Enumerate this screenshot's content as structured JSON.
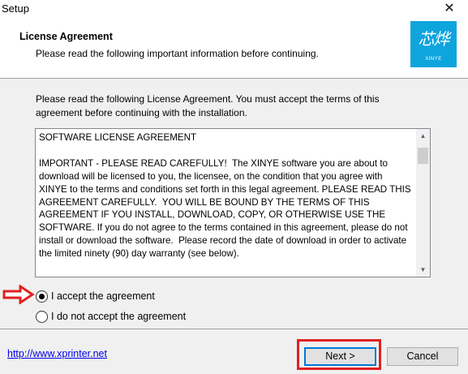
{
  "window": {
    "title": "Setup",
    "close_glyph": "✕"
  },
  "header": {
    "title": "License Agreement",
    "subtitle": "Please read the following important information before continuing.",
    "logo": {
      "glyph": "芯烨",
      "brand": "XINYE",
      "background": "#0ea5dd"
    }
  },
  "intro_text": "Please read the following License Agreement. You must accept the terms of this agreement before continuing with the installation.",
  "license": {
    "text": "SOFTWARE LICENSE AGREEMENT\n\nIMPORTANT - PLEASE READ CAREFULLY!  The XINYE software you are about to download will be licensed to you, the licensee, on the condition that you agree with XINYE to the terms and conditions set forth in this legal agreement. PLEASE READ THIS AGREEMENT CAREFULLY.  YOU WILL BE BOUND BY THE TERMS OF THIS AGREEMENT IF YOU INSTALL, DOWNLOAD, COPY, OR OTHERWISE USE THE SOFTWARE. If you do not agree to the terms contained in this agreement, please do not install or download the software.  Please record the date of download in order to activate the limited ninety (90) day warranty (see below)."
  },
  "options": [
    {
      "label": "I accept the agreement",
      "checked": true
    },
    {
      "label": "I do not accept the agreement",
      "checked": false
    }
  ],
  "footer": {
    "link": "http://www.xprinter.net",
    "next_label": "Next >",
    "cancel_label": "Cancel"
  },
  "colors": {
    "annotation": "#e02020",
    "focus": "#0078d7",
    "link": "#0000ee"
  }
}
